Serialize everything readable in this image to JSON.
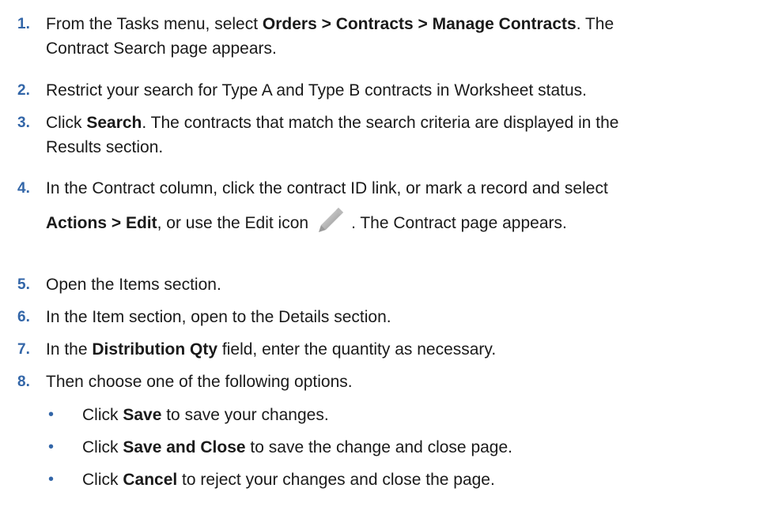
{
  "steps": [
    {
      "num": "1.",
      "p1": "From the Tasks menu, select ",
      "b1": "Orders > Contracts > Manage Contracts",
      "p2": ". The",
      "line2": "Contract Search page appears."
    },
    {
      "num": "2.",
      "text": "Restrict your search for Type A and Type B contracts in Worksheet status."
    },
    {
      "num": "3.",
      "p1": "Click ",
      "b1": "Search",
      "p2": ". The contracts that match the search criteria are displayed in the",
      "line2": "Results section."
    },
    {
      "num": "4.",
      "line1": "In the Contract column, click the contract ID link, or mark a record and select",
      "b1": "Actions > Edit",
      "p1": ", or use the Edit icon",
      "p2": ". The Contract page appears.",
      "icon": "pencil-edit-icon"
    },
    {
      "num": "5.",
      "text": "Open the Items section."
    },
    {
      "num": "6.",
      "text": "In the Item section, open to the Details section."
    },
    {
      "num": "7.",
      "p1": "In the ",
      "b1": "Distribution Qty",
      "p2": " field, enter the quantity as necessary."
    },
    {
      "num": "8.",
      "text": "Then choose one of the following options."
    }
  ],
  "options": [
    {
      "bullet": "•",
      "p1": "Click ",
      "b1": "Save",
      "p2": " to save your changes."
    },
    {
      "bullet": "•",
      "p1": "Click ",
      "b1": "Save and Close",
      "p2": " to save the change and close page."
    },
    {
      "bullet": "•",
      "p1": "Click ",
      "b1": "Cancel",
      "p2": " to reject your changes and close the page."
    }
  ]
}
